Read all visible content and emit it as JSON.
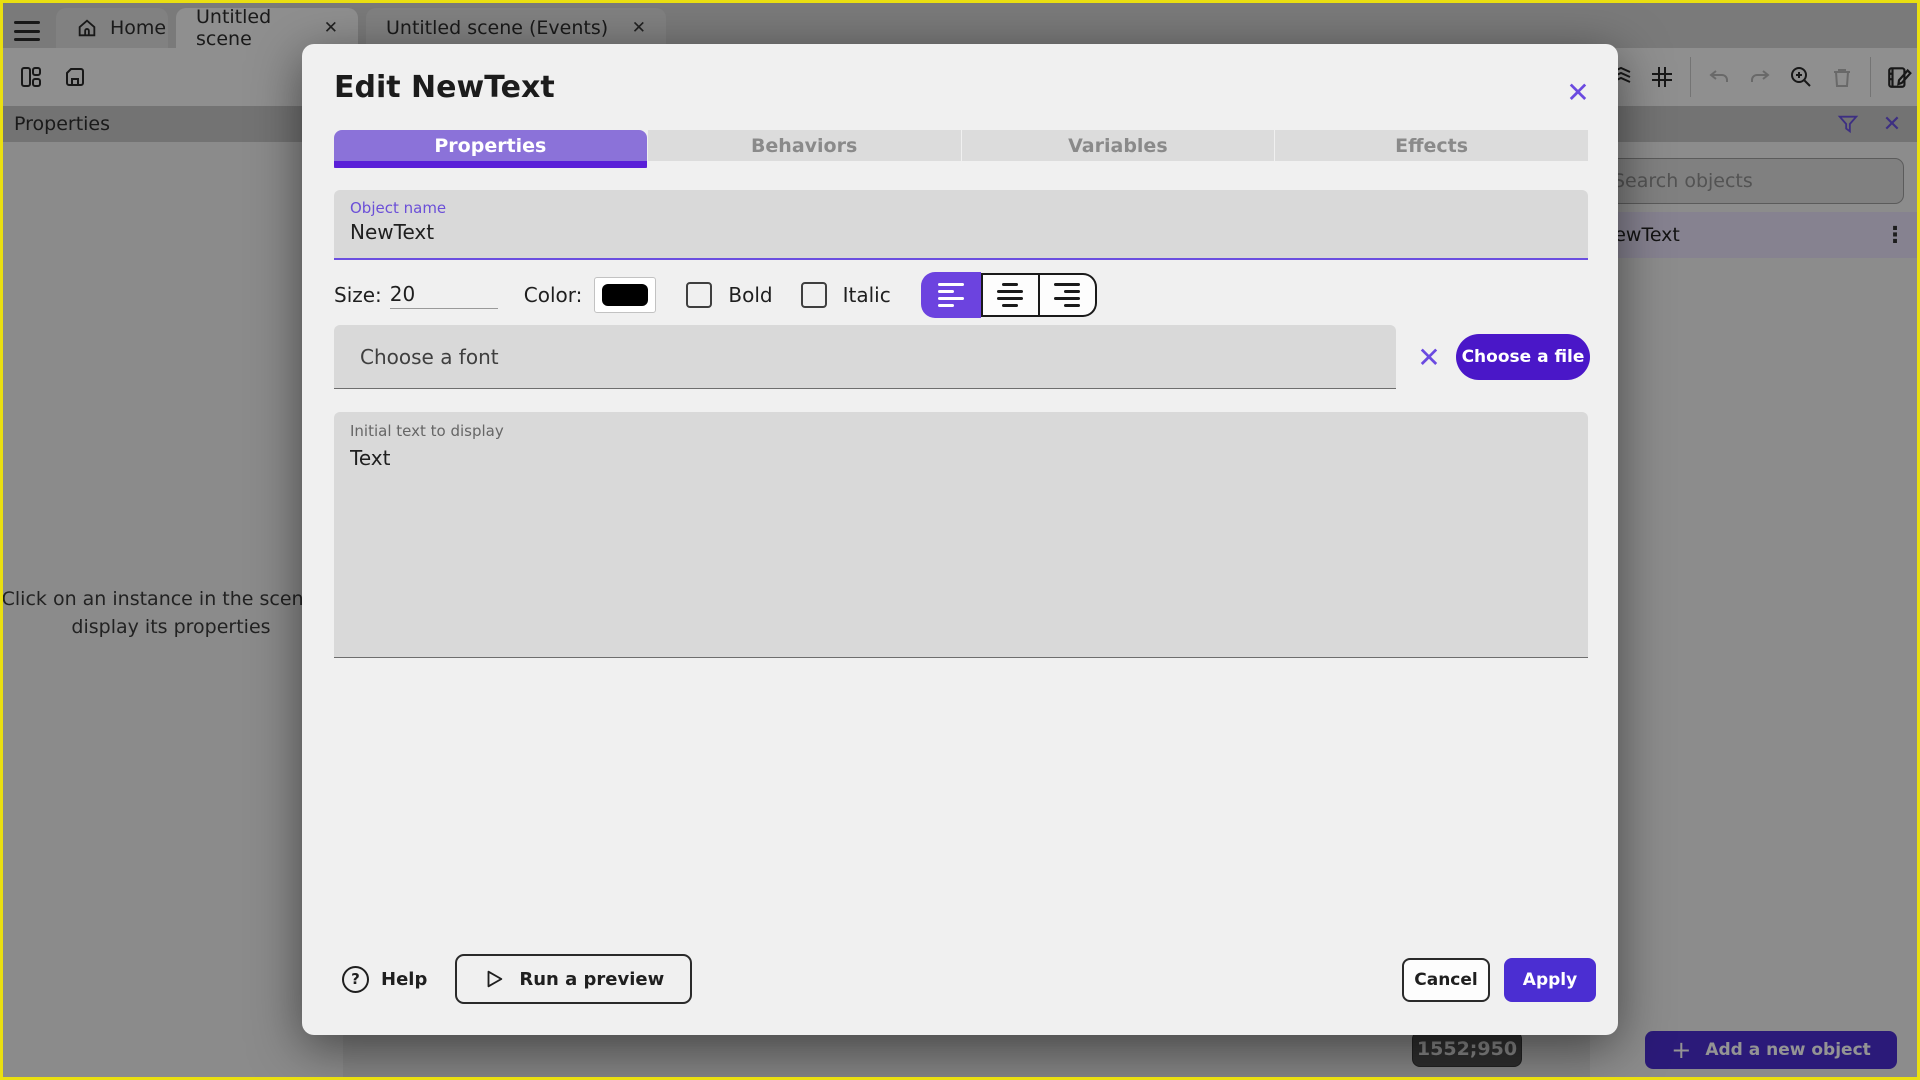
{
  "topbar": {
    "tabs": [
      {
        "label": "Home"
      },
      {
        "label": "Untitled scene",
        "close": "✕"
      },
      {
        "label": "Untitled scene (Events)",
        "close": "✕"
      }
    ]
  },
  "left_panel": {
    "header": "Properties",
    "empty_message_line1": "Click on an instance in the scene to",
    "empty_message_line2": "display its properties"
  },
  "right_panel": {
    "search_placeholder": "Search objects",
    "object_name": "NewText",
    "kebab": "⋮",
    "add_button_label": "Add a new object",
    "plus": "+"
  },
  "canvas": {
    "coordinates_badge": "1552;950"
  },
  "modal": {
    "title": "Edit NewText",
    "close": "✕",
    "tabs": [
      {
        "label": "Properties"
      },
      {
        "label": "Behaviors"
      },
      {
        "label": "Variables"
      },
      {
        "label": "Effects"
      }
    ],
    "object_name_label": "Object name",
    "object_name_value": "NewText",
    "size_label": "Size:",
    "size_value": "20",
    "color_label": "Color:",
    "bold_label": "Bold",
    "italic_label": "Italic",
    "font_placeholder": "Choose a font",
    "clear_font": "✕",
    "choose_file_label": "Choose a file",
    "initial_text_label": "Initial text to display",
    "initial_text_value": "Text",
    "help_label": "Help",
    "help_glyph": "?",
    "run_preview_label": "Run a preview",
    "cancel_label": "Cancel",
    "apply_label": "Apply"
  },
  "colors": {
    "accent_purple": "#6c43df",
    "modal_tab_selected": "#8b72d9",
    "modal_tab_strip": "#5a1fd8",
    "primary_button": "#4b2ed2",
    "choose_file_button": "#4a17c8",
    "field_label_purple": "#6b4fd8",
    "selected_object_row": "#e7e1f8",
    "window_border": "#eadf10",
    "text_color_swatch": "#000000"
  }
}
